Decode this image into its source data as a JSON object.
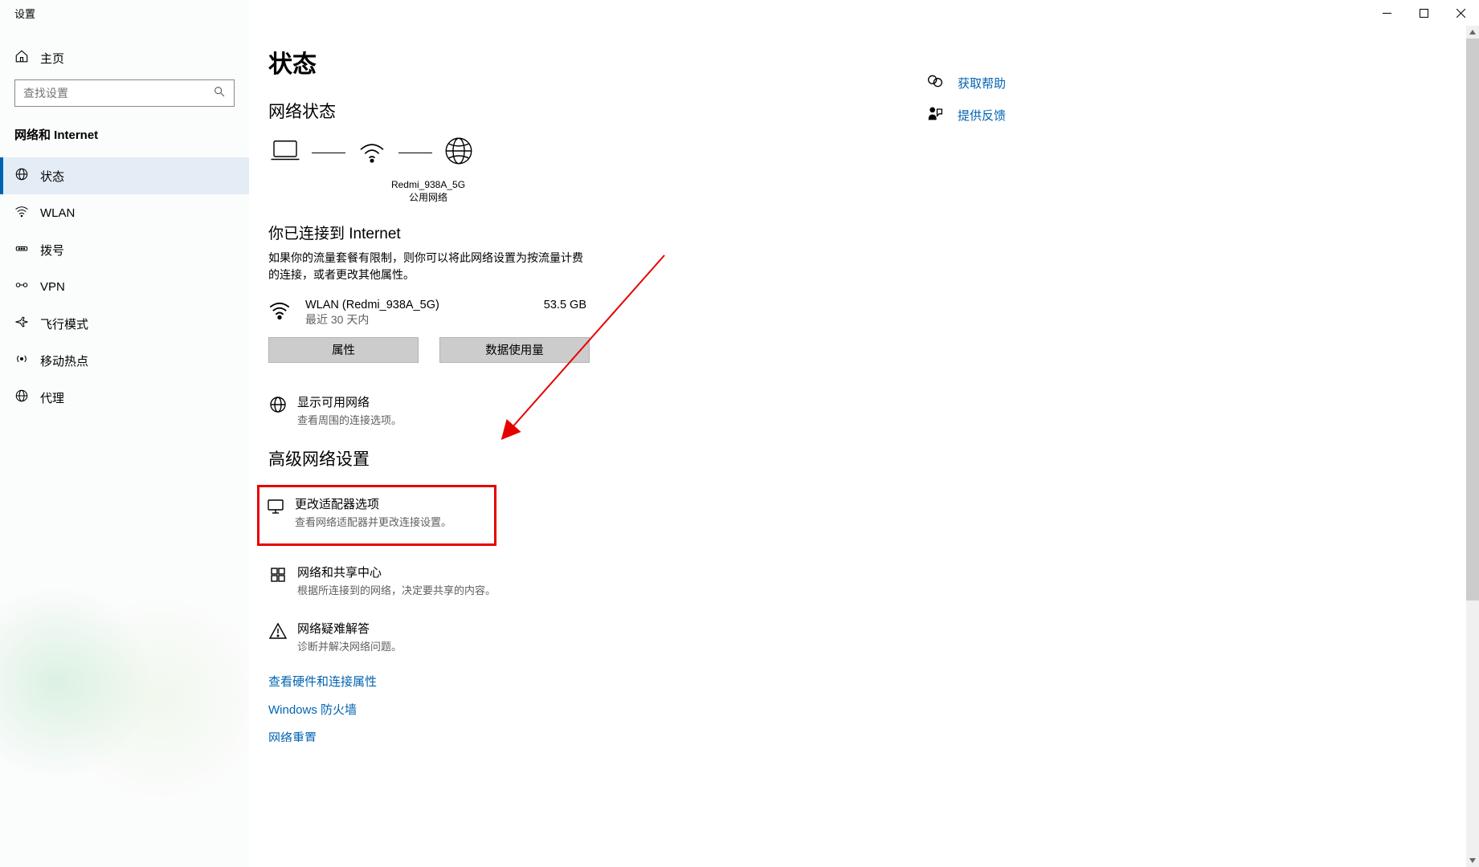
{
  "app_title": "设置",
  "sidebar": {
    "home": "主页",
    "search_placeholder": "查找设置",
    "section_title": "网络和 Internet",
    "items": [
      {
        "label": "状态"
      },
      {
        "label": "WLAN"
      },
      {
        "label": "拨号"
      },
      {
        "label": "VPN"
      },
      {
        "label": "飞行模式"
      },
      {
        "label": "移动热点"
      },
      {
        "label": "代理"
      }
    ]
  },
  "main": {
    "page_title": "状态",
    "network_status_header": "网络状态",
    "topology": {
      "ssid": "Redmi_938A_5G",
      "network_type": "公用网络"
    },
    "connected_title": "你已连接到 Internet",
    "connected_desc": "如果你的流量套餐有限制，则你可以将此网络设置为按流量计费的连接，或者更改其他属性。",
    "connection": {
      "name": "WLAN (Redmi_938A_5G)",
      "period": "最近 30 天内",
      "usage": "53.5 GB"
    },
    "buttons": {
      "properties": "属性",
      "data_usage": "数据使用量"
    },
    "show_networks": {
      "title": "显示可用网络",
      "desc": "查看周围的连接选项。"
    },
    "advanced_header": "高级网络设置",
    "adapter": {
      "title": "更改适配器选项",
      "desc": "查看网络适配器并更改连接设置。"
    },
    "sharing": {
      "title": "网络和共享中心",
      "desc": "根据所连接到的网络，决定要共享的内容。"
    },
    "troubleshoot": {
      "title": "网络疑难解答",
      "desc": "诊断并解决网络问题。"
    },
    "links": {
      "hardware": "查看硬件和连接属性",
      "firewall": "Windows 防火墙",
      "reset": "网络重置"
    }
  },
  "aside": {
    "get_help": "获取帮助",
    "feedback": "提供反馈"
  },
  "colors": {
    "accent": "#0063b1",
    "highlight": "#e60000"
  }
}
